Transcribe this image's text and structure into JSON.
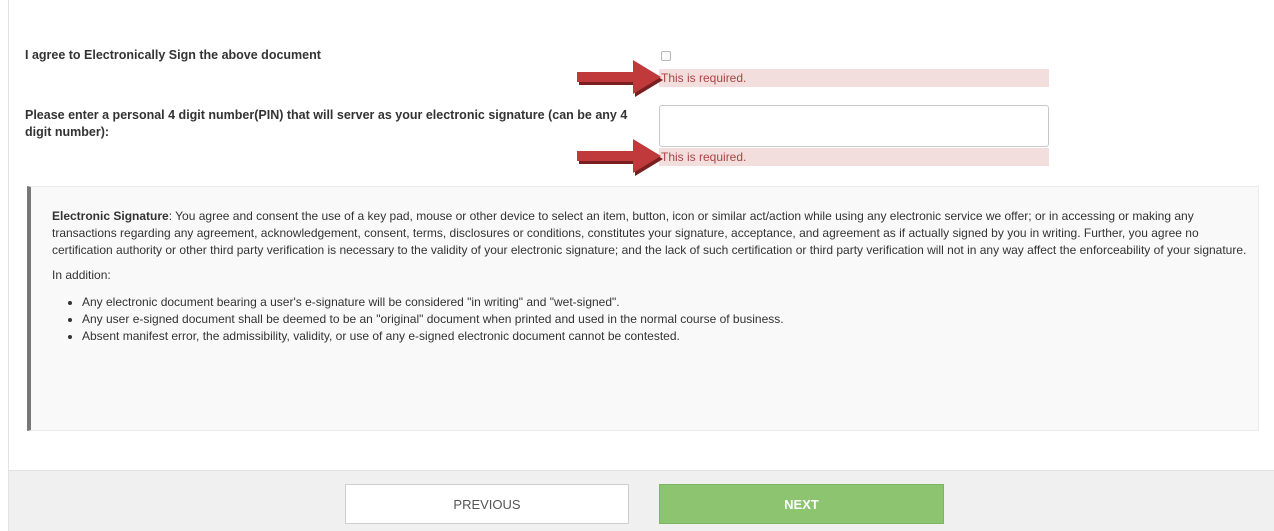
{
  "form": {
    "agree_label": "I agree to Electronically Sign the above document",
    "agree_checked": false,
    "agree_error": "This is required.",
    "pin_label": "Please enter a personal 4 digit number(PIN) that will server as your electronic signature (can be any 4 digit number):",
    "pin_value": "",
    "pin_error": "This is required."
  },
  "annotations": {
    "arrow_color": "#c0393b",
    "arrow_icon": "right-arrow-icon"
  },
  "notice": {
    "term": "Electronic Signature",
    "body": ": You agree and consent the use of a key pad, mouse or other device to select an item, button, icon or similar act/action while using any electronic service we offer; or in accessing or making any transactions regarding any agreement, acknowledgement, consent, terms, disclosures or conditions, constitutes your signature, acceptance, and agreement as if actually signed by you in writing. Further, you agree no certification authority or other third party verification is necessary to the validity of your electronic signature; and the lack of such certification or third party verification will not in any way affect the enforceability of your signature.",
    "in_addition": "In addition:",
    "bullets": [
      "Any electronic document bearing a user's e-signature will be considered \"in writing\" and \"wet-signed\".",
      "Any user e-signed document shall be deemed to be an \"original\" document when printed and used in the normal course of business.",
      "Absent manifest error, the admissibility, validity, or use of any e-signed electronic document cannot be contested."
    ]
  },
  "footer": {
    "previous_label": "PREVIOUS",
    "next_label": "NEXT",
    "next_color": "#8cc46f"
  }
}
